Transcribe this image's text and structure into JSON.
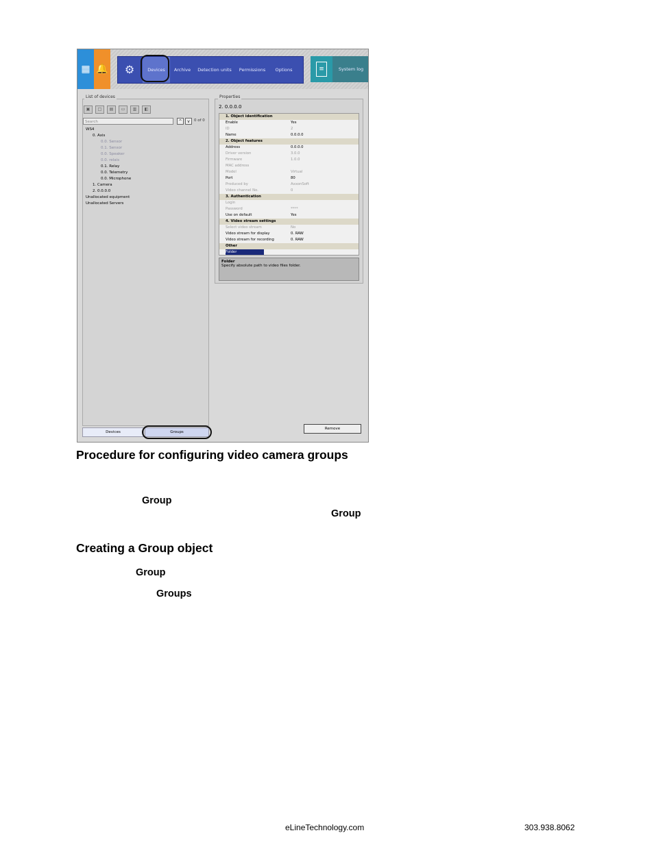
{
  "topbar": {
    "tabs": [
      "Devices",
      "Archive",
      "Detection units",
      "Permissions",
      "Options"
    ],
    "system_log": "System log"
  },
  "devices_panel": {
    "title": "List of devices",
    "search_placeholder": "Search",
    "count": "0 of 0",
    "tree": [
      "WS4",
      "0. Axis",
      "0.0. Sensor",
      "0.1. Sensor",
      "0.0. Speaker",
      "0.0. relais",
      "0.1. Relay",
      "0.0. Telemetry",
      "0.0. Microphone",
      "1. Camera",
      "2. 0.0.0.0",
      "Unallocated equipment",
      "Unallocated Servers"
    ],
    "bottom_tabs": [
      "Devices",
      "Groups"
    ]
  },
  "properties": {
    "title": "Properties",
    "object": "2. 0.0.0.0",
    "rows": [
      {
        "k": "1. Object identification",
        "v": "",
        "hdr": true
      },
      {
        "k": "Enable",
        "v": "Yes"
      },
      {
        "k": "ID",
        "v": "2",
        "gray": true
      },
      {
        "k": "Name",
        "v": "0.0.0.0"
      },
      {
        "k": "2. Object features",
        "v": "",
        "hdr": true
      },
      {
        "k": "Address",
        "v": "0.0.0.0"
      },
      {
        "k": "Driver version",
        "v": "3.0.0",
        "gray": true
      },
      {
        "k": "Firmware",
        "v": "1.0.0",
        "gray": true
      },
      {
        "k": "MAC address",
        "v": "",
        "gray": true
      },
      {
        "k": "Model",
        "v": "Virtual",
        "gray": true
      },
      {
        "k": "Port",
        "v": "80"
      },
      {
        "k": "Produced by",
        "v": "AxxonSoft",
        "gray": true
      },
      {
        "k": "Video channel No.",
        "v": "0",
        "gray": true
      },
      {
        "k": "3. Authentication",
        "v": "",
        "hdr": true
      },
      {
        "k": "Login",
        "v": "",
        "gray": true
      },
      {
        "k": "Password",
        "v": "****",
        "gray": true
      },
      {
        "k": "Use on default",
        "v": "Yes"
      },
      {
        "k": "4. Video stream settings",
        "v": "",
        "hdr": true
      },
      {
        "k": "Select video stream",
        "v": "No",
        "gray": true
      },
      {
        "k": "Video stream for display",
        "v": "0. RAW"
      },
      {
        "k": "Video stream for recording",
        "v": "0. RAW"
      },
      {
        "k": "Other",
        "v": "",
        "hdr": true
      },
      {
        "k": "Folder",
        "v": "",
        "sel": true
      }
    ],
    "desc_title": "Folder",
    "desc_text": "Specify absolute path to video files folder.",
    "remove": "Remove"
  },
  "doc": {
    "heading1": "Procedure for configuring video camera groups",
    "group_word": "Group",
    "heading2": "Creating a Group object",
    "groups_word": "Groups"
  },
  "footer": {
    "site": "eLineTechnology.com",
    "phone": "303.938.8062"
  }
}
